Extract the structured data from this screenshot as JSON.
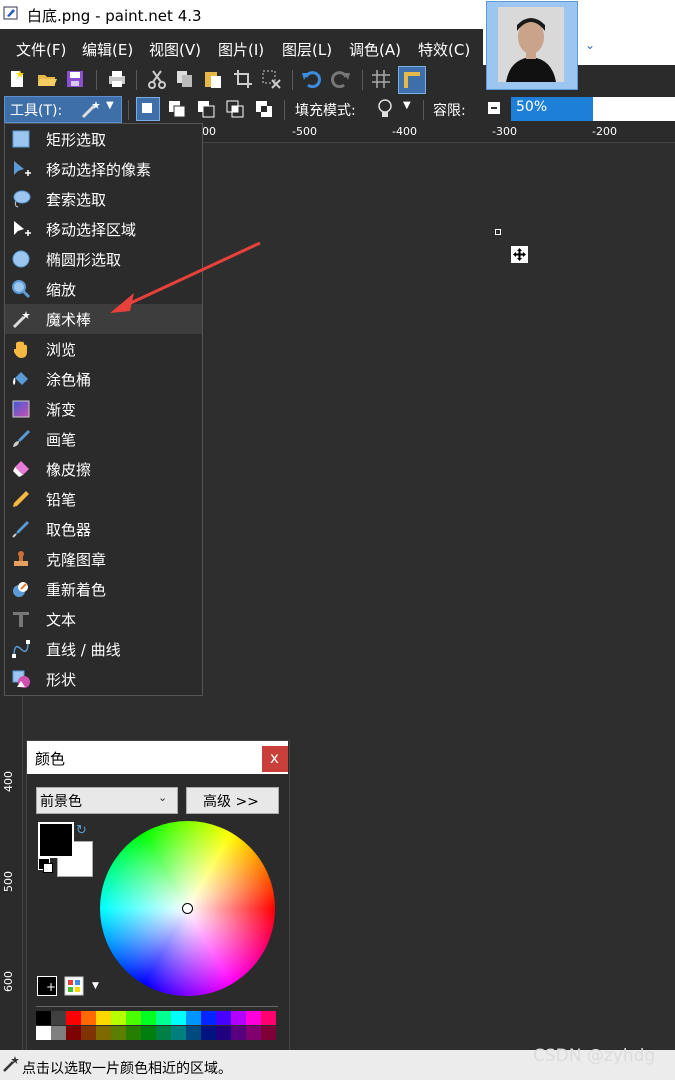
{
  "window": {
    "title": "白底.png - paint.net 4.3"
  },
  "menu": [
    "文件(F)",
    "编辑(E)",
    "视图(V)",
    "图片(I)",
    "图层(L)",
    "调色(A)",
    "特效(C)"
  ],
  "options": {
    "tool_label": "工具(T):",
    "fill_mode_label": "填充模式:",
    "tolerance_label": "容限:",
    "tolerance_value": "50%",
    "tolerance_fraction": 0.5
  },
  "ruler": {
    "top_labels": [
      "00",
      "-500",
      "-400",
      "-300",
      "-200"
    ],
    "left_labels": [
      "400",
      "500",
      "600"
    ]
  },
  "tool_menu": [
    {
      "label": "矩形选取",
      "icon": "rect-select-icon"
    },
    {
      "label": "移动选择的像素",
      "icon": "move-pixels-icon"
    },
    {
      "label": "套索选取",
      "icon": "lasso-icon"
    },
    {
      "label": "移动选择区域",
      "icon": "move-selection-icon"
    },
    {
      "label": "椭圆形选取",
      "icon": "ellipse-select-icon"
    },
    {
      "label": "缩放",
      "icon": "zoom-icon"
    },
    {
      "label": "魔术棒",
      "icon": "magic-wand-icon"
    },
    {
      "label": "浏览",
      "icon": "pan-hand-icon"
    },
    {
      "label": "涂色桶",
      "icon": "paint-bucket-icon"
    },
    {
      "label": "渐变",
      "icon": "gradient-icon"
    },
    {
      "label": "画笔",
      "icon": "paintbrush-icon"
    },
    {
      "label": "橡皮擦",
      "icon": "eraser-icon"
    },
    {
      "label": "铅笔",
      "icon": "pencil-icon"
    },
    {
      "label": "取色器",
      "icon": "color-picker-icon"
    },
    {
      "label": "克隆图章",
      "icon": "clone-stamp-icon"
    },
    {
      "label": "重新着色",
      "icon": "recolor-icon"
    },
    {
      "label": "文本",
      "icon": "text-icon"
    },
    {
      "label": "直线 / 曲线",
      "icon": "line-curve-icon"
    },
    {
      "label": "形状",
      "icon": "shapes-icon"
    }
  ],
  "colors_panel": {
    "title": "颜色",
    "close": "x",
    "select_value": "前景色",
    "advanced_label": "高级 >>",
    "primary_color": "#000000",
    "secondary_color": "#ffffff"
  },
  "palette_top": [
    "#000000",
    "#404040",
    "#ff0000",
    "#ff6a00",
    "#ffd800",
    "#b6ff00",
    "#4cff00",
    "#00ff21",
    "#00ff90",
    "#00ffff",
    "#0094ff",
    "#0026ff",
    "#4800ff",
    "#b200ff",
    "#ff00dc",
    "#ff006e"
  ],
  "palette_bottom": [
    "#ffffff",
    "#808080",
    "#7f0000",
    "#7f3300",
    "#7f6a00",
    "#5b7f00",
    "#267f00",
    "#007f0e",
    "#007f46",
    "#007f7f",
    "#004a7f",
    "#00137f",
    "#21007f",
    "#57007f",
    "#7f006e",
    "#7f0037"
  ],
  "status": {
    "text": "点击以选取一片颜色相近的区域。"
  },
  "watermark": "CSDN @zyhdg"
}
